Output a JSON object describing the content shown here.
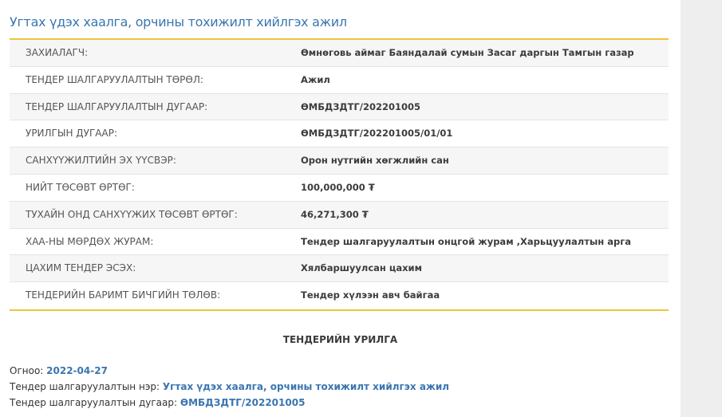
{
  "title": "Угтах үдэх хаалга, орчины тохижилт хийлгэх ажил",
  "rows": [
    {
      "label": "ЗАХИАЛАГЧ:",
      "value": "Өмнөговь аймаг Баяндалай сумын Засаг даргын Тамгын газар"
    },
    {
      "label": "ТЕНДЕР ШАЛГАРУУЛАЛТЫН ТӨРӨЛ:",
      "value": "Ажил"
    },
    {
      "label": "ТЕНДЕР ШАЛГАРУУЛАЛТЫН ДУГААР:",
      "value": "ӨМБДЗДТГ/202201005"
    },
    {
      "label": "УРИЛГЫН ДУГААР:",
      "value": "ӨМБДЗДТГ/202201005/01/01"
    },
    {
      "label": "САНХҮҮЖИЛТИЙН ЭХ ҮҮСВЭР:",
      "value": "Орон нутгийн хөгжлийн сан"
    },
    {
      "label": "НИЙТ ТӨСӨВТ ӨРТӨГ:",
      "value": "100,000,000 ₮"
    },
    {
      "label": "ТУХАЙН ОНД САНХҮҮЖИХ ТӨСӨВТ ӨРТӨГ:",
      "value": "46,271,300 ₮"
    },
    {
      "label": "ХАА-НЫ МӨРДӨХ ЖУРАМ:",
      "value": "Тендер шалгаруулалтын онцгой журам ,Харьцуулалтын арга"
    },
    {
      "label": "ЦАХИМ ТЕНДЕР ЭСЭХ:",
      "value": "Хялбаршуулсан цахим"
    },
    {
      "label": "ТЕНДЕРИЙН БАРИМТ БИЧГИЙН ТӨЛӨВ:",
      "value": "Тендер хүлээн авч байгаа"
    }
  ],
  "section_title": "ТЕНДЕРИЙН УРИЛГА",
  "info": {
    "date_label": "Огноо:",
    "date_value": "2022-04-27",
    "name_label": "Тендер шалгаруулалтын нэр:",
    "name_value": "Угтах үдэх хаалга, орчины тохижилт хийлгэх ажил",
    "number_label": "Тендер шалгаруулалтын дугаар:",
    "number_value": "ӨМБДЗДТГ/202201005"
  },
  "colors": {
    "accent": "#3a76b0",
    "divider": "#f0c43c"
  }
}
